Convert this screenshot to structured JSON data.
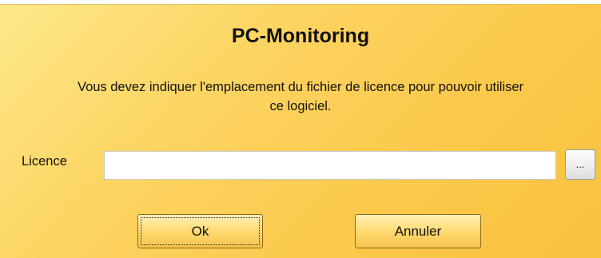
{
  "dialog": {
    "title": "PC-Monitoring",
    "message_line1": "Vous devez indiquer l'emplacement du fichier de licence pour pouvoir utiliser",
    "message_line2": "ce logiciel.",
    "licence_label": "Licence",
    "licence_value": "",
    "browse_label": "...",
    "ok_label": "Ok",
    "cancel_label": "Annuler"
  },
  "colors": {
    "background_gradient_start": "#fde88a",
    "background_gradient_end": "#f8c23f",
    "button_gradient_top": "#fff0b8",
    "button_gradient_bottom": "#f7c34a"
  }
}
